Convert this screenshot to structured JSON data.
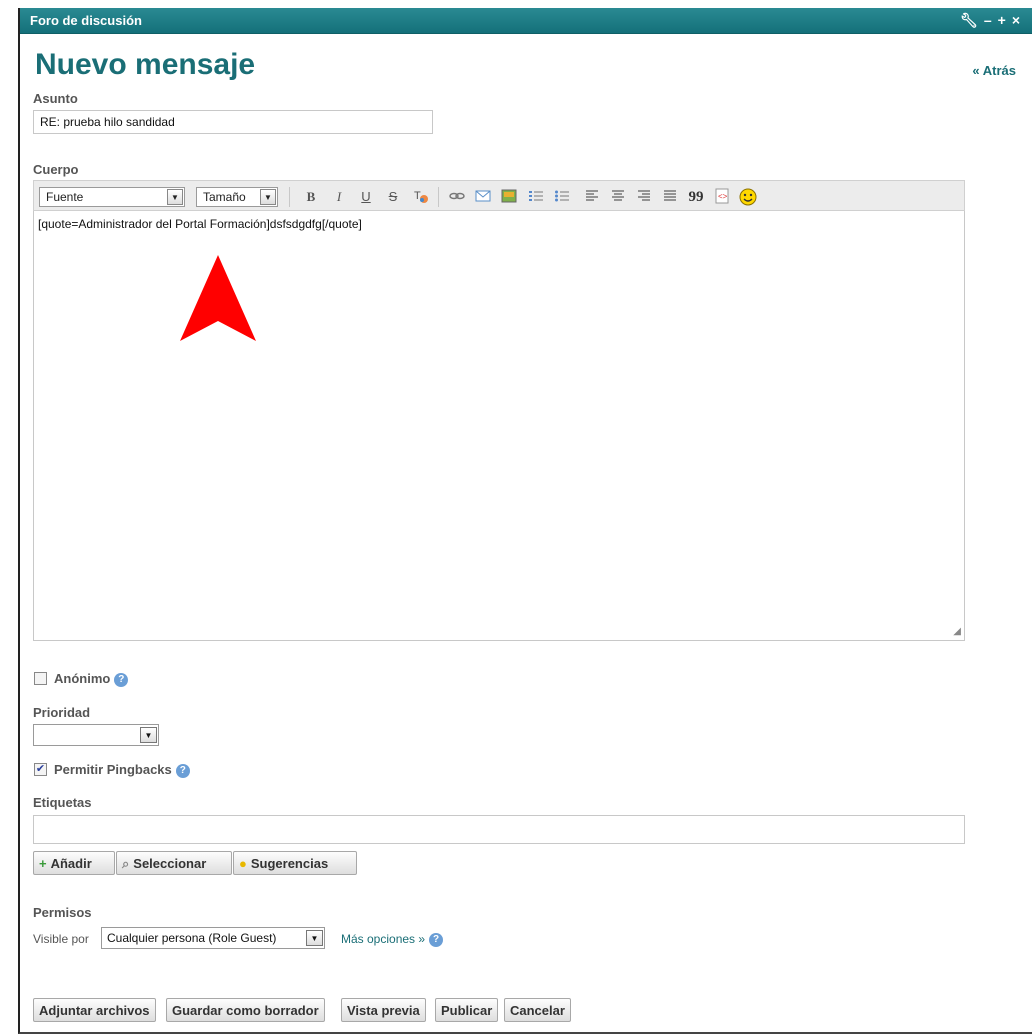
{
  "window": {
    "title": "Foro de discusión",
    "controls": [
      "wrench-icon",
      "minimize-icon",
      "maximize-icon",
      "close-icon"
    ]
  },
  "page": {
    "title": "Nuevo mensaje",
    "back_link": "« Atrás"
  },
  "subject": {
    "label": "Asunto",
    "value": "RE: prueba hilo sandidad"
  },
  "body": {
    "label": "Cuerpo",
    "font_select": "Fuente",
    "size_select": "Tamaño",
    "toolbar_icons": [
      "bold-icon",
      "italic-icon",
      "underline-icon",
      "strikethrough-icon",
      "text-color-icon",
      "link-icon",
      "email-icon",
      "image-icon",
      "ordered-list-icon",
      "unordered-list-icon",
      "align-left-icon",
      "align-center-icon",
      "align-right-icon",
      "justify-icon",
      "quote-icon",
      "code-icon",
      "emoticon-icon"
    ],
    "toolbar_glyphs": {
      "bold": "B",
      "italic": "I",
      "underline": "U",
      "strike": "S",
      "quote": "99"
    },
    "content": "[quote=Administrador del Portal Formación]dsfsdgdfg[/quote]"
  },
  "anonymous": {
    "label": "Anónimo",
    "checked": false
  },
  "priority": {
    "label": "Prioridad",
    "value": ""
  },
  "pingbacks": {
    "label": "Permitir Pingbacks",
    "checked": true
  },
  "tags": {
    "label": "Etiquetas",
    "value": "",
    "buttons": {
      "add": "Añadir",
      "select": "Seleccionar",
      "suggestions": "Sugerencias"
    }
  },
  "permissions": {
    "label": "Permisos",
    "visible_by_label": "Visible por",
    "visible_by_value": "Cualquier persona (Role Guest)",
    "more_options": "Más opciones »"
  },
  "actions": {
    "attach": "Adjuntar archivos",
    "save_draft": "Guardar como borrador",
    "preview": "Vista previa",
    "publish": "Publicar",
    "cancel": "Cancelar"
  },
  "colors": {
    "accent": "#1a6e76",
    "titlebar": "#14707a",
    "annotation_arrow": "#ff0000"
  }
}
